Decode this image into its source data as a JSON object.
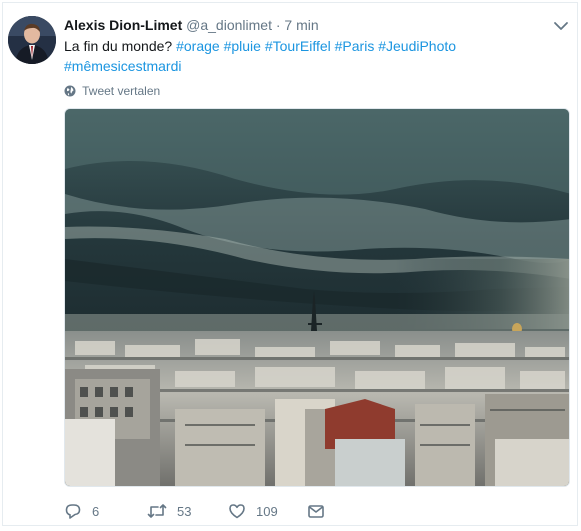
{
  "tweet": {
    "name": "Alexis Dion-Limet",
    "handle": "@a_dionlimet",
    "separator": "·",
    "time": "7 min",
    "text_prefix": "La fin du monde?",
    "hashtags": [
      "#orage",
      "#pluie",
      "#TourEiffel",
      "#Paris",
      "#JeudiPhoto",
      "#mêmesicestmardi"
    ],
    "translate_label": "Tweet vertalen"
  },
  "actions": {
    "replies": "6",
    "retweets": "53",
    "likes": "109"
  },
  "icons": {
    "more": "chevron-down-icon",
    "translate": "globe-icon",
    "reply": "reply-icon",
    "retweet": "retweet-icon",
    "like": "heart-icon",
    "dm": "envelope-icon"
  },
  "colors": {
    "link": "#1b95e0",
    "muted": "#657786",
    "text": "#14171a"
  }
}
